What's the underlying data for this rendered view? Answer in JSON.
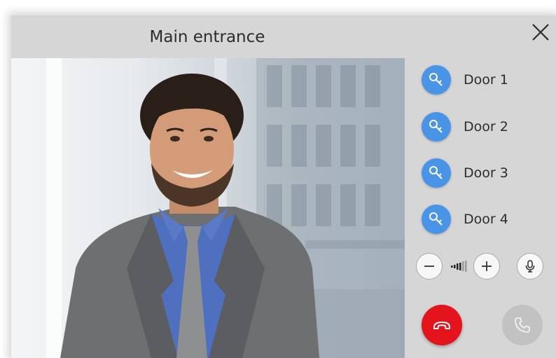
{
  "window": {
    "title": "Main entrance"
  },
  "doors": [
    {
      "label": "Door 1",
      "icon": "key-icon"
    },
    {
      "label": "Door 2",
      "icon": "key-icon"
    },
    {
      "label": "Door 3",
      "icon": "key-icon"
    },
    {
      "label": "Door 4",
      "icon": "key-icon"
    }
  ],
  "audio_controls": {
    "volume_down_icon": "minus-icon",
    "volume_up_icon": "plus-icon",
    "microphone_icon": "microphone-icon"
  },
  "call_controls": {
    "hangup_icon": "phone-hangup-icon",
    "answer_icon": "phone-answer-icon",
    "answer_enabled": false
  },
  "colors": {
    "key_button": "#4a94e8",
    "hangup": "#e3141c",
    "answer_disabled": "#c2c2c2",
    "window_bg": "#d6d6d6"
  }
}
